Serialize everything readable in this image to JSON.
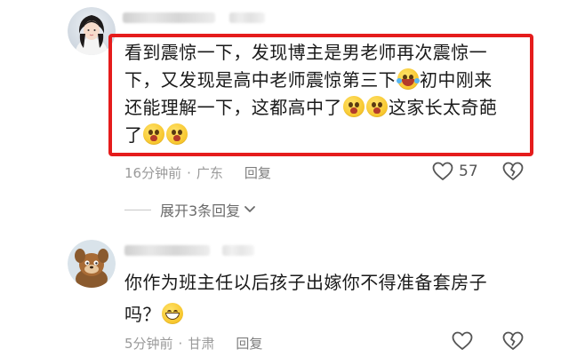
{
  "comments": [
    {
      "text_lines": [
        [
          "看到震惊一下，发现博主是男老师再次震惊一"
        ],
        [
          "下，又发现是高中老师震惊第三下",
          "初中刚来"
        ],
        [
          "还能理解一下，这都高中了",
          "这家长太奇葩"
        ],
        [
          "了"
        ]
      ],
      "time": "16分钟前",
      "location": "广东",
      "reply_label": "回复",
      "likes": "57",
      "expand_label": "展开3条回复",
      "highlight_color": "#e51c1c"
    },
    {
      "text_lines": [
        [
          "你作为班主任以后孩子出嫁你不得准备套房子"
        ],
        [
          "吗？"
        ]
      ],
      "time": "5分钟前",
      "location": "甘肃",
      "reply_label": "回复",
      "likes": ""
    }
  ],
  "separator": "·",
  "icons": {
    "like": "heart-outline-icon",
    "dislike": "broken-heart-icon",
    "expand": "chevron-down-icon",
    "emoji_laugh": "laughing-tears-emoji",
    "emoji_shock": "shocked-face-emoji",
    "emoji_grin": "grinning-face-emoji"
  }
}
